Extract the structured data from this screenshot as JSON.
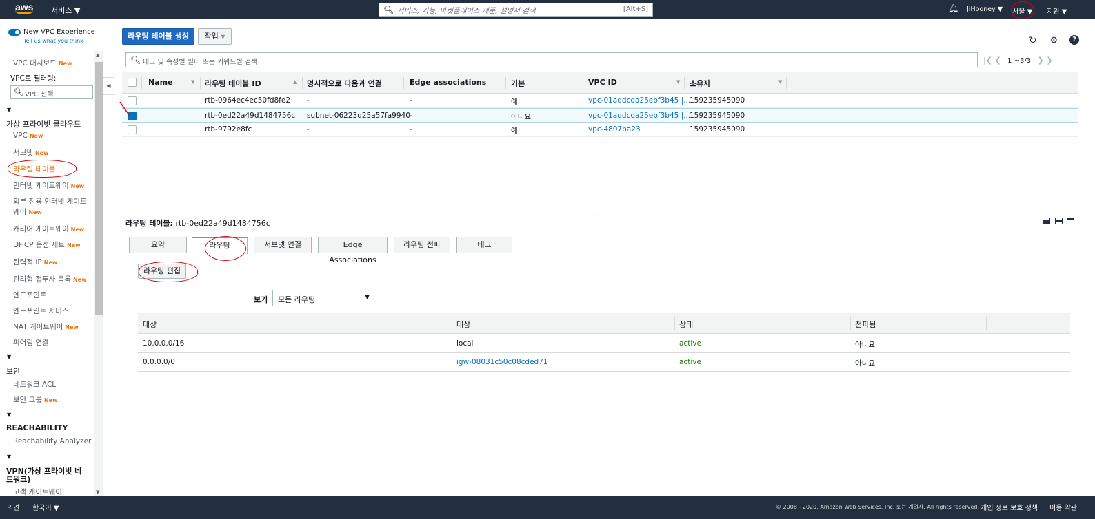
{
  "topnav": {
    "logo": "aws",
    "services_label": "서비스 ▼",
    "search_placeholder": "서비스, 기능, 마켓플레이스 제품, 설명서 검색",
    "search_shortcut": "[Alt+S]",
    "user_label": "JiHooney ▼",
    "region_label": "서울 ▼",
    "support_label": "지원 ▼"
  },
  "sidebar": {
    "toggle_label": "New VPC Experience",
    "toggle_sub": "Tell us what you think",
    "dashboard": "VPC 대시보드",
    "filter_label": "VPC로 필터링:",
    "filter_placeholder": "VPC 선택",
    "new_badge": "New",
    "section_vpc": "가상 프라이빗 클라우드",
    "items_vpc": [
      {
        "label": "VPC",
        "new": true
      },
      {
        "label": "서브넷",
        "new": true
      },
      {
        "label": "라우팅 테이블",
        "new": false
      },
      {
        "label": "인터넷 게이트웨이",
        "new": true
      },
      {
        "label": "외부 전용 인터넷 게이트",
        "new": false
      },
      {
        "label": "웨이",
        "new": true
      },
      {
        "label": "캐리어 게이트웨이",
        "new": true
      },
      {
        "label": "DHCP 옵션 세트",
        "new": true
      },
      {
        "label": "탄력적 IP",
        "new": true
      },
      {
        "label": "관리형 접두사 목록",
        "new": true
      },
      {
        "label": "엔드포인트",
        "new": false
      },
      {
        "label": "엔드포인트 서비스",
        "new": false
      },
      {
        "label": "NAT 게이트웨이",
        "new": true
      },
      {
        "label": "피어링 연결",
        "new": false
      }
    ],
    "section_security": "보안",
    "items_security": [
      {
        "label": "네트워크 ACL",
        "new": false
      },
      {
        "label": "보안 그룹",
        "new": true
      }
    ],
    "section_reach": "REACHABILITY",
    "items_reach": [
      {
        "label": "Reachability Analyzer"
      }
    ],
    "section_vpn_1": "VPN(가상 프라이빗 네",
    "section_vpn_2": "트워크)",
    "items_vpn": [
      {
        "label": "고객 게이트웨이"
      }
    ]
  },
  "toolbar": {
    "create_label": "라우팅 테이블 생성",
    "actions_label": "작업"
  },
  "filter": {
    "placeholder": "태그 및 속성별 필터 또는 키워드별 검색",
    "pager": "1 ~3/3"
  },
  "grid": {
    "columns": [
      "Name",
      "라우팅 테이블 ID",
      "명시적으로 다음과 연결",
      "Edge associations",
      "기본",
      "VPC ID",
      "소유자"
    ],
    "rows": [
      {
        "name": "",
        "id": "rtb-0964ec4ec50fd8fe2",
        "explicit": "-",
        "edge": "-",
        "main": "예",
        "vpc": "vpc-01addcda25ebf3b45 |...",
        "owner": "159235945090",
        "selected": false
      },
      {
        "name": "",
        "id": "rtb-0ed22a49d1484756c",
        "explicit": "subnet-06223d25a57fa9940",
        "edge": "-",
        "main": "아니요",
        "vpc": "vpc-01addcda25ebf3b45 |...",
        "owner": "159235945090",
        "selected": true
      },
      {
        "name": "",
        "id": "rtb-9792e8fc",
        "explicit": "-",
        "edge": "-",
        "main": "예",
        "vpc": "vpc-4807ba23",
        "owner": "159235945090",
        "selected": false
      }
    ]
  },
  "detail": {
    "title_label": "라우팅 테이블:",
    "title_value": "rtb-0ed22a49d1484756c",
    "tabs": [
      "요약",
      "라우팅",
      "서브넷 연결",
      "Edge Associations",
      "라우팅 전파",
      "태그"
    ],
    "active_tab": "라우팅",
    "edit_label": "라우팅 편집",
    "view_label": "보기",
    "view_value": "모든 라우팅",
    "columns": [
      "대상",
      "대상",
      "상태",
      "전파됨"
    ],
    "routes": [
      {
        "dest": "10.0.0.0/16",
        "target": "local",
        "status": "active",
        "propagated": "아니요"
      },
      {
        "dest": "0.0.0.0/0",
        "target": "igw-08031c50c08cded71",
        "status": "active",
        "propagated": "아니요"
      }
    ]
  },
  "footer": {
    "feedback": "의견",
    "language": "한국어 ▼",
    "copyright": "© 2008 - 2020, Amazon Web Services, Inc. 또는 계열사. All rights reserved.",
    "privacy": "개인 정보 보호 정책",
    "terms": "이용 약관"
  },
  "colors": {
    "nav_bg": "#232f3e",
    "primary": "#1f69c1",
    "link": "#0073bb",
    "accent": "#ec7211",
    "active_status": "#1d8102",
    "annotation": "#e0000b"
  }
}
